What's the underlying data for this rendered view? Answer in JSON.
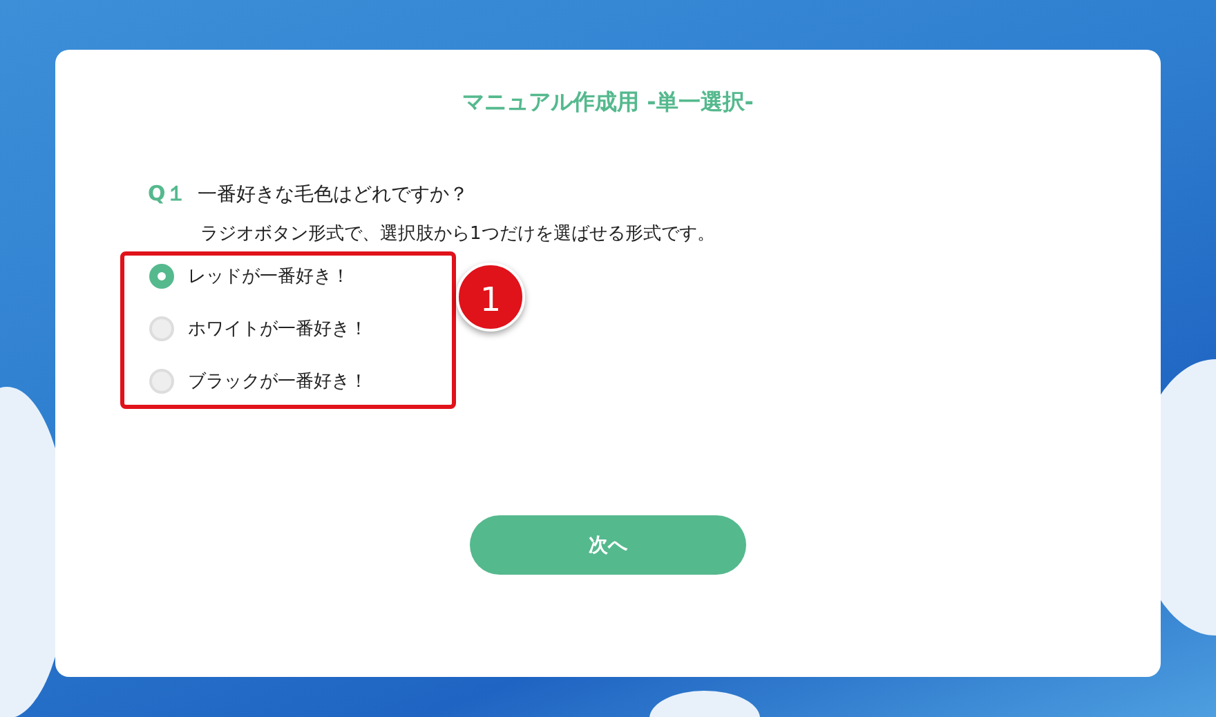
{
  "card": {
    "title": "マニュアル作成用 -単一選択-"
  },
  "question": {
    "number": "Q１",
    "text": "一番好きな毛色はどれですか？",
    "note": "ラジオボタン形式で、選択肢から1つだけを選ばせる形式です。"
  },
  "options": [
    {
      "label": "レッドが一番好き！",
      "selected": true
    },
    {
      "label": "ホワイトが一番好き！",
      "selected": false
    },
    {
      "label": "ブラックが一番好き！",
      "selected": false
    }
  ],
  "next_button": {
    "label": "次へ"
  },
  "annotation": {
    "number": "1"
  }
}
